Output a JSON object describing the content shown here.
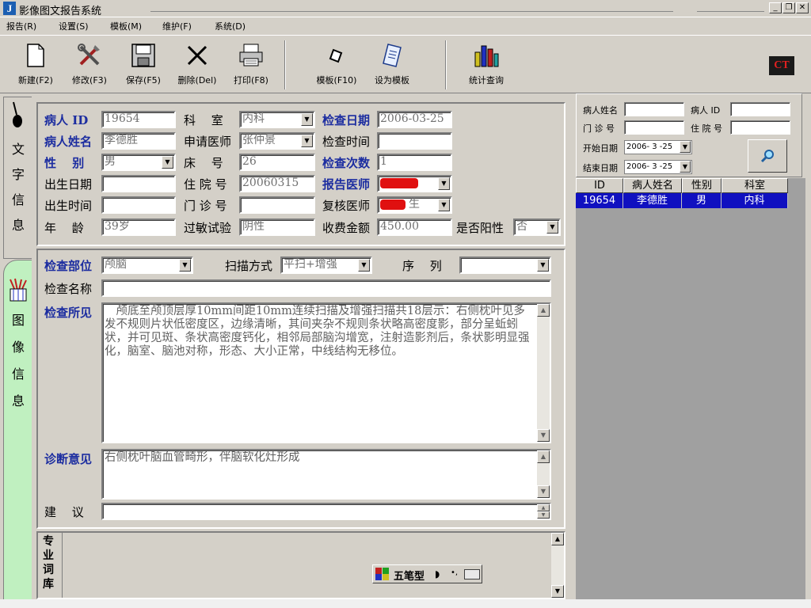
{
  "window": {
    "title": "影像图文报告系统",
    "logo": "J"
  },
  "menu": [
    "报告(R)",
    "设置(S)",
    "模板(M)",
    "维护(F)",
    "系统(D)"
  ],
  "toolbar": {
    "new": "新建(F2)",
    "edit": "修改(F3)",
    "save": "保存(F5)",
    "delete": "删除(Del)",
    "print": "打印(F8)",
    "template": "模板(F10)",
    "set_template": "设为模板",
    "stats": "统计查询",
    "badge": "CT"
  },
  "tabs": {
    "text_info": [
      "文",
      "字",
      "信",
      "息"
    ],
    "image_info": [
      "图",
      "像",
      "信",
      "息"
    ]
  },
  "patient": {
    "id_label": "病人 ID",
    "id": "19654",
    "dept_label": "科　 室",
    "dept": "内科",
    "exam_date_label": "检查日期",
    "exam_date": "2006-03-25",
    "name_label": "病人姓名",
    "name": "李德胜",
    "req_doctor_label": "申请医师",
    "req_doctor": "张仲景",
    "exam_time_label": "检查时间",
    "exam_time": "",
    "sex_label": "性　 别",
    "sex": "男",
    "bed_label": "床　 号",
    "bed": "26",
    "exam_count_label": "检查次数",
    "exam_count": "1",
    "birth_date_label": "出生日期",
    "birth_date": "",
    "inpatient_label": "住 院 号",
    "inpatient": "20060315",
    "report_doctor_label": "报告医师",
    "birth_time_label": "出生时间",
    "birth_time": "",
    "outpatient_label": "门 诊 号",
    "outpatient": "",
    "review_doctor_label": "复核医师",
    "review_doctor_suffix": "生",
    "age_label": "年　 龄",
    "age": "39岁",
    "allergy_label": "过敏试验",
    "allergy": "阴性",
    "fee_label": "收费金额",
    "fee": "450.00",
    "positive_label": "是否阳性",
    "positive": "否"
  },
  "exam": {
    "part_label": "检查部位",
    "part": "颅脑",
    "scan_label": "扫描方式",
    "scan": "平扫+增强",
    "seq_label": "序　 列",
    "seq": "",
    "name_label": "检查名称",
    "name": "",
    "findings_label": "检查所见",
    "findings": "　颅底至颅顶层厚10mm间距10mm连续扫描及增强扫描共18层示：右侧枕叶见多发不规则片状低密度区，边缘清晰，其间夹杂不规则条状略高密度影，部分呈蚯蚓状，并可见斑、条状高密度钙化，相邻局部脑沟增宽，注射造影剂后，条状影明显强化，脑室、脑池对称，形态、大小正常，中线结构无移位。",
    "diagnosis_label": "诊断意见",
    "diagnosis": "右侧枕叶脑血管畸形，伴脑软化灶形成",
    "advice_label": "建　 议",
    "advice": ""
  },
  "lexicon": {
    "label": [
      "专",
      "业",
      "词",
      "库"
    ]
  },
  "ime": {
    "mode": "五笔型"
  },
  "search": {
    "name_label": "病人姓名",
    "id_label": "病人 ID",
    "outpatient_label": "门 诊 号",
    "inpatient_label": "住 院 号",
    "start_label": "开始日期",
    "start": "2006- 3 -25",
    "end_label": "结束日期",
    "end": "2006- 3 -25"
  },
  "results": {
    "columns": [
      "ID",
      "病人姓名",
      "性别",
      "科室"
    ],
    "rows": [
      [
        "19654",
        "李德胜",
        "男",
        "内科"
      ]
    ]
  }
}
